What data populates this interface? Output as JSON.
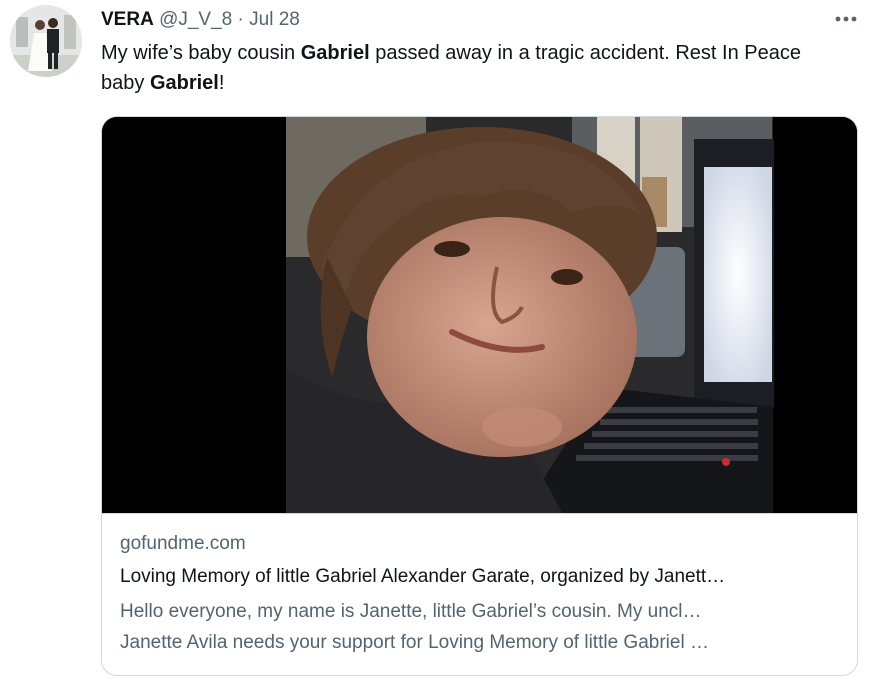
{
  "tweet": {
    "display_name": "VERA",
    "handle": "@J_V_8",
    "separator": "·",
    "date": "Jul 28",
    "more_icon": "more-dots-icon",
    "text_parts": [
      {
        "text": "My wife’s baby cousin ",
        "bold": false
      },
      {
        "text": "Gabriel",
        "bold": true
      },
      {
        "text": " passed away in a tragic accident. Rest In Peace baby ",
        "bold": false
      },
      {
        "text": "Gabriel",
        "bold": true
      },
      {
        "text": "!",
        "bold": false
      }
    ]
  },
  "card": {
    "domain": "gofundme.com",
    "title": "Loving Memory of little Gabriel Alexander Garate, organized by Janett…",
    "description_line1": "Hello everyone, my name is Janette, little Gabriel’s cousin. My uncl…",
    "description_line2": "Janette Avila needs your support for Loving Memory of little Gabriel …"
  },
  "colors": {
    "text_primary": "#0f1419",
    "text_secondary": "#536471",
    "border": "#cfd9de"
  }
}
